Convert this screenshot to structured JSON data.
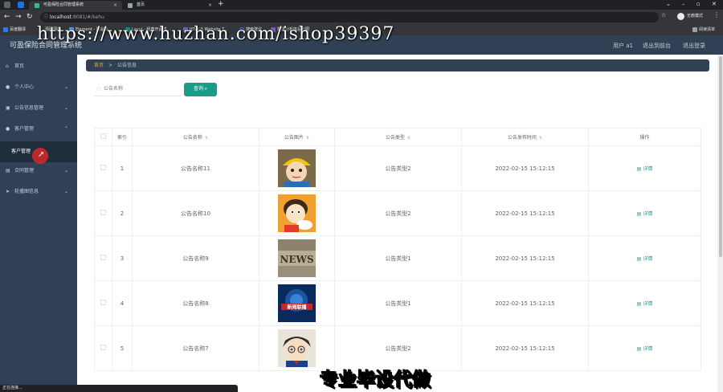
{
  "browser": {
    "tabs": [
      {
        "title": "可盈保险合同管理系统",
        "active": true
      },
      {
        "title": "首页",
        "active": false
      }
    ],
    "new_tab_glyph": "+",
    "url_host": "localhost",
    "url_path": ":8081/#/kehu",
    "profile_label": "无痕模式",
    "bookmarks": [
      "百度翻译",
      "源码网站",
      "Element - 网站快...",
      "Layui - 经典开源模...",
      "HTML5 Website T...",
      "搜索建议",
      "数据分析库总览图"
    ],
    "bookmark_folder": "阅读清单",
    "status_text": "正在连接..."
  },
  "header": {
    "title": "可盈保险合同管理系统",
    "user": "用户 a1",
    "back_to_front": "退出到前台",
    "logout": "退出登录"
  },
  "sidebar": {
    "items": [
      {
        "label": "首页",
        "icon": "home-icon",
        "chevron": ""
      },
      {
        "label": "个人中心",
        "icon": "user-icon",
        "chevron": "⌄"
      },
      {
        "label": "公告信息管理",
        "icon": "document-icon",
        "chevron": "⌄"
      },
      {
        "label": "客户管理",
        "icon": "user-icon",
        "chevron": "⌃"
      },
      {
        "label": "合同管理",
        "icon": "folder-icon",
        "chevron": "⌄"
      },
      {
        "label": "轮播图信息",
        "icon": "send-icon",
        "chevron": "⌄"
      }
    ],
    "sub_item": "客户管理"
  },
  "breadcrumb": {
    "home": "首页",
    "separator": ">",
    "current": "公告信息"
  },
  "search": {
    "placeholder": "公告名称",
    "button_label": "查询"
  },
  "table": {
    "columns": [
      "索引",
      "公告名称",
      "公告图片",
      "公告类型",
      "公告发布时间",
      "操作"
    ],
    "action_label": "详情",
    "rows": [
      {
        "index": "1",
        "name": "公告名称11",
        "image": "cartoon-boy-hat",
        "type": "公告类型2",
        "time": "2022-02-15 15:12:15"
      },
      {
        "index": "2",
        "name": "公告名称10",
        "image": "cartoon-kid-yellow",
        "type": "公告类型2",
        "time": "2022-02-15 15:12:15"
      },
      {
        "index": "3",
        "name": "公告名称9",
        "image": "news-letters",
        "type": "公告类型1",
        "time": "2022-02-15 15:12:15"
      },
      {
        "index": "4",
        "name": "公告名称8",
        "image": "news-globe-blue",
        "type": "公告类型1",
        "time": "2022-02-15 15:12:15"
      },
      {
        "index": "5",
        "name": "公告名称7",
        "image": "cartoon-detective",
        "type": "公告类型2",
        "time": "2022-02-15 15:12:15"
      }
    ],
    "news_text": "NEWS",
    "banner_text": "新闻联播"
  },
  "overlays": {
    "watermark": "https://www.huzhan.com/ishop39397",
    "caption": "专业毕设代做"
  },
  "colors": {
    "sidebar": "#304156",
    "accent": "#1a9c8b",
    "breadcrumb_active": "#e6a23c"
  }
}
